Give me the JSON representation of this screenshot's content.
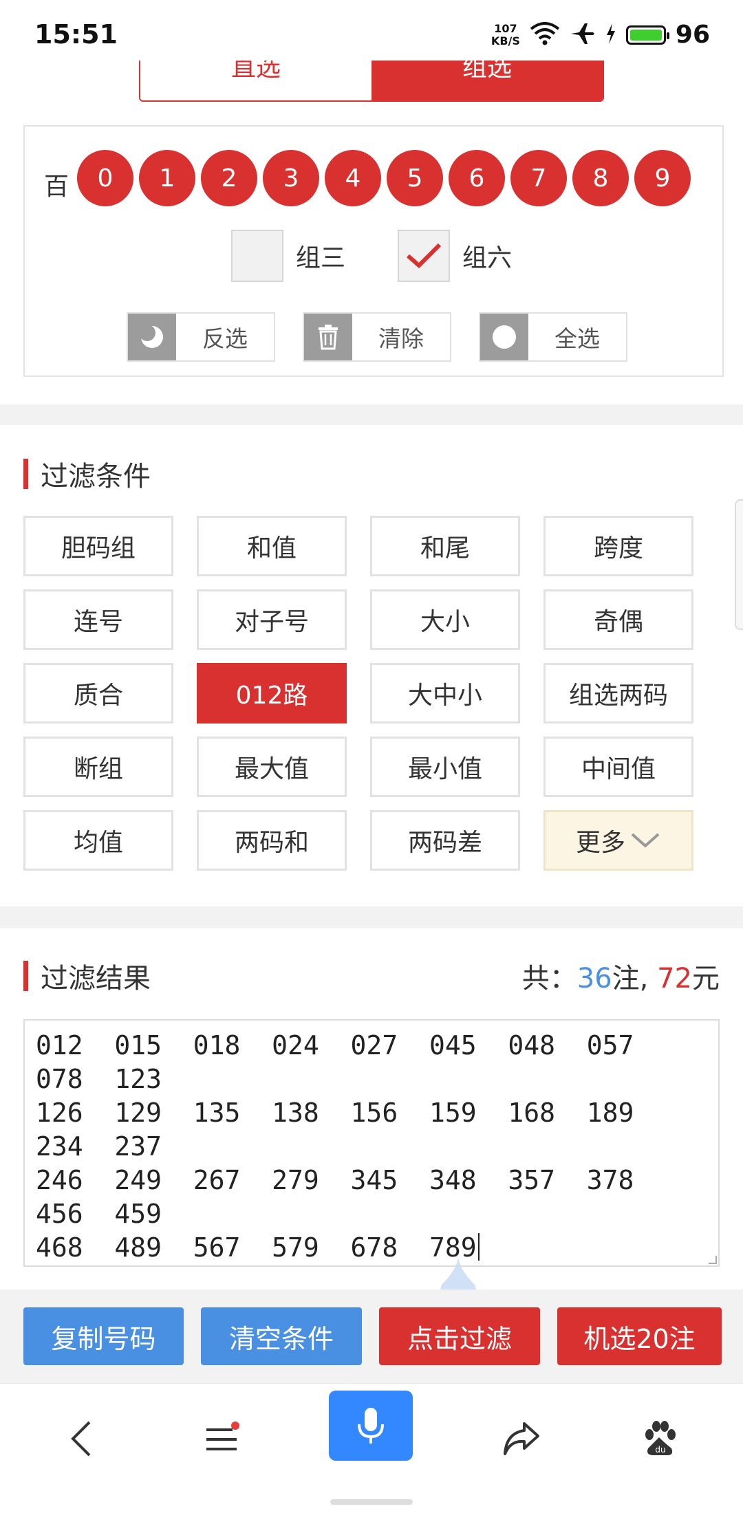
{
  "status": {
    "time": "15:51",
    "net_speed_value": "107",
    "net_speed_unit": "KB/S",
    "battery": "96",
    "icons": [
      "wifi-icon",
      "airplane-icon",
      "charging-icon",
      "battery-icon"
    ]
  },
  "tabs": {
    "left": "直选",
    "right": "组选",
    "active": "组选"
  },
  "picker": {
    "row_label": "百",
    "balls": [
      "0",
      "1",
      "2",
      "3",
      "4",
      "5",
      "6",
      "7",
      "8",
      "9"
    ],
    "checks": [
      {
        "label": "组三",
        "checked": false
      },
      {
        "label": "组六",
        "checked": true
      }
    ],
    "actions": [
      {
        "label": "反选",
        "icon": "moon-icon"
      },
      {
        "label": "清除",
        "icon": "trash-icon"
      },
      {
        "label": "全选",
        "icon": "circle-icon"
      }
    ]
  },
  "filters": {
    "title": "过滤条件",
    "items": [
      "胆码组",
      "和值",
      "和尾",
      "跨度",
      "连号",
      "对子号",
      "大小",
      "奇偶",
      "质合",
      "012路",
      "大中小",
      "组选两码",
      "断组",
      "最大值",
      "最小值",
      "中间值",
      "均值",
      "两码和",
      "两码差",
      "更多"
    ],
    "active": "012路"
  },
  "results": {
    "title": "过滤结果",
    "total_prefix": "共：",
    "count": "36",
    "count_unit": "注,",
    "amount": "72",
    "amount_unit": "元",
    "numbers": "012  015  018  024  027  045  048  057  078  123\n126  129  135  138  156  159  168  189  234  237\n246  249  267  279  345  348  357  378  456  459\n468  489  567  579  678  789"
  },
  "bottom_buttons": {
    "copy": "复制号码",
    "clear": "清空条件",
    "filter": "点击过滤",
    "random": "机选20注"
  },
  "colors": {
    "red": "#d93030",
    "blue": "#4a90e2",
    "more_bg": "#fdf5e4"
  }
}
